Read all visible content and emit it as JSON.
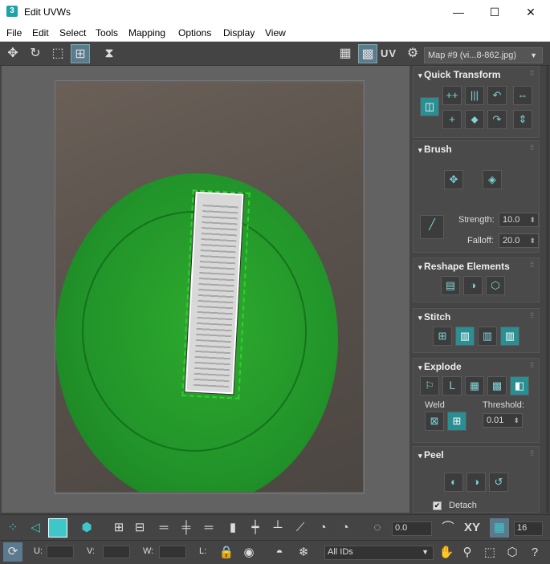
{
  "window": {
    "title": "Edit UVWs",
    "app_icon": "3",
    "minimize": "—",
    "maximize": "☐",
    "close": "✕"
  },
  "menu": [
    "File",
    "Edit",
    "Select",
    "Tools",
    "Mapping",
    "Options",
    "Display",
    "View"
  ],
  "toolbar": {
    "uv_label": "UV",
    "map_select": "Map #9 (vi...8-862.jpg)"
  },
  "panel": {
    "quick_transform": {
      "title": "Quick Transform"
    },
    "brush": {
      "title": "Brush",
      "strength_label": "Strength:",
      "strength_value": "10.0",
      "falloff_label": "Falloff:",
      "falloff_value": "20.0"
    },
    "reshape": {
      "title": "Reshape Elements"
    },
    "stitch": {
      "title": "Stitch"
    },
    "explode": {
      "title": "Explode",
      "weld_label": "Weld",
      "threshold_label": "Threshold:",
      "threshold_value": "0.01"
    },
    "peel": {
      "title": "Peel",
      "detach_label": "Detach",
      "detach_checked": "✔"
    }
  },
  "bottom": {
    "rotate_value": "0.0",
    "xy_label": "XY",
    "grid_value": "16",
    "u_label": "U:",
    "v_label": "V:",
    "w_label": "W:",
    "l_label": "L:",
    "ids_select": "All IDs"
  },
  "colors": {
    "accent": "#2a8f93",
    "uv_edge": "#2ed12e",
    "plate": "#22952a"
  }
}
